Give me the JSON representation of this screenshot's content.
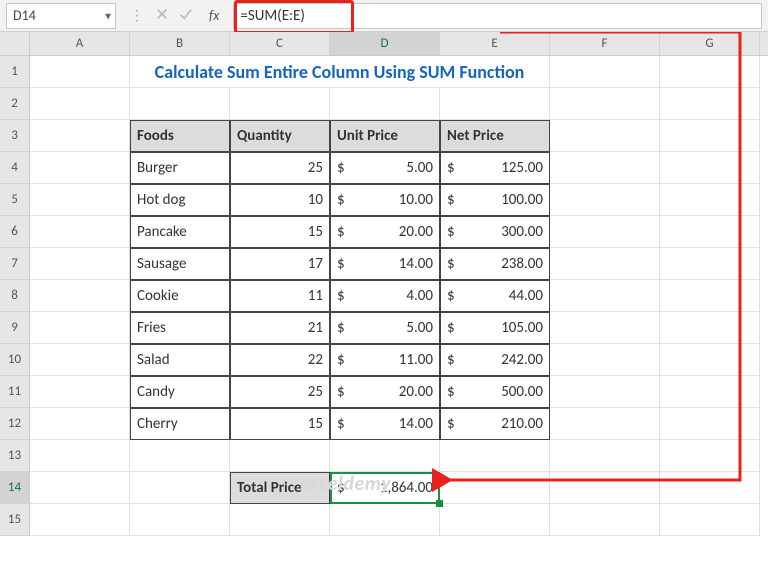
{
  "name_box": "D14",
  "formula": "=SUM(E:E)",
  "fx_label": "fx",
  "columns": [
    "A",
    "B",
    "C",
    "D",
    "E",
    "F",
    "G"
  ],
  "rows": [
    "1",
    "2",
    "3",
    "4",
    "5",
    "6",
    "7",
    "8",
    "9",
    "10",
    "11",
    "12",
    "13",
    "14",
    "15"
  ],
  "selected_col": "D",
  "selected_row": "14",
  "title": "Calculate Sum Entire Column Using SUM Function",
  "table": {
    "headers": [
      "Foods",
      "Quantity",
      "Unit Price",
      "Net Price"
    ],
    "rows": [
      {
        "food": "Burger",
        "qty": "25",
        "unit": "5.00",
        "net": "125.00"
      },
      {
        "food": "Hot dog",
        "qty": "10",
        "unit": "10.00",
        "net": "100.00"
      },
      {
        "food": "Pancake",
        "qty": "15",
        "unit": "20.00",
        "net": "300.00"
      },
      {
        "food": "Sausage",
        "qty": "17",
        "unit": "14.00",
        "net": "238.00"
      },
      {
        "food": "Cookie",
        "qty": "11",
        "unit": "4.00",
        "net": "44.00"
      },
      {
        "food": "Fries",
        "qty": "21",
        "unit": "5.00",
        "net": "105.00"
      },
      {
        "food": "Salad",
        "qty": "22",
        "unit": "11.00",
        "net": "242.00"
      },
      {
        "food": "Candy",
        "qty": "25",
        "unit": "20.00",
        "net": "500.00"
      },
      {
        "food": "Cherry",
        "qty": "15",
        "unit": "14.00",
        "net": "210.00"
      }
    ]
  },
  "currency": "$",
  "total_label": "Total Price",
  "total_value": "1,864.00",
  "watermark": "exceldemy"
}
